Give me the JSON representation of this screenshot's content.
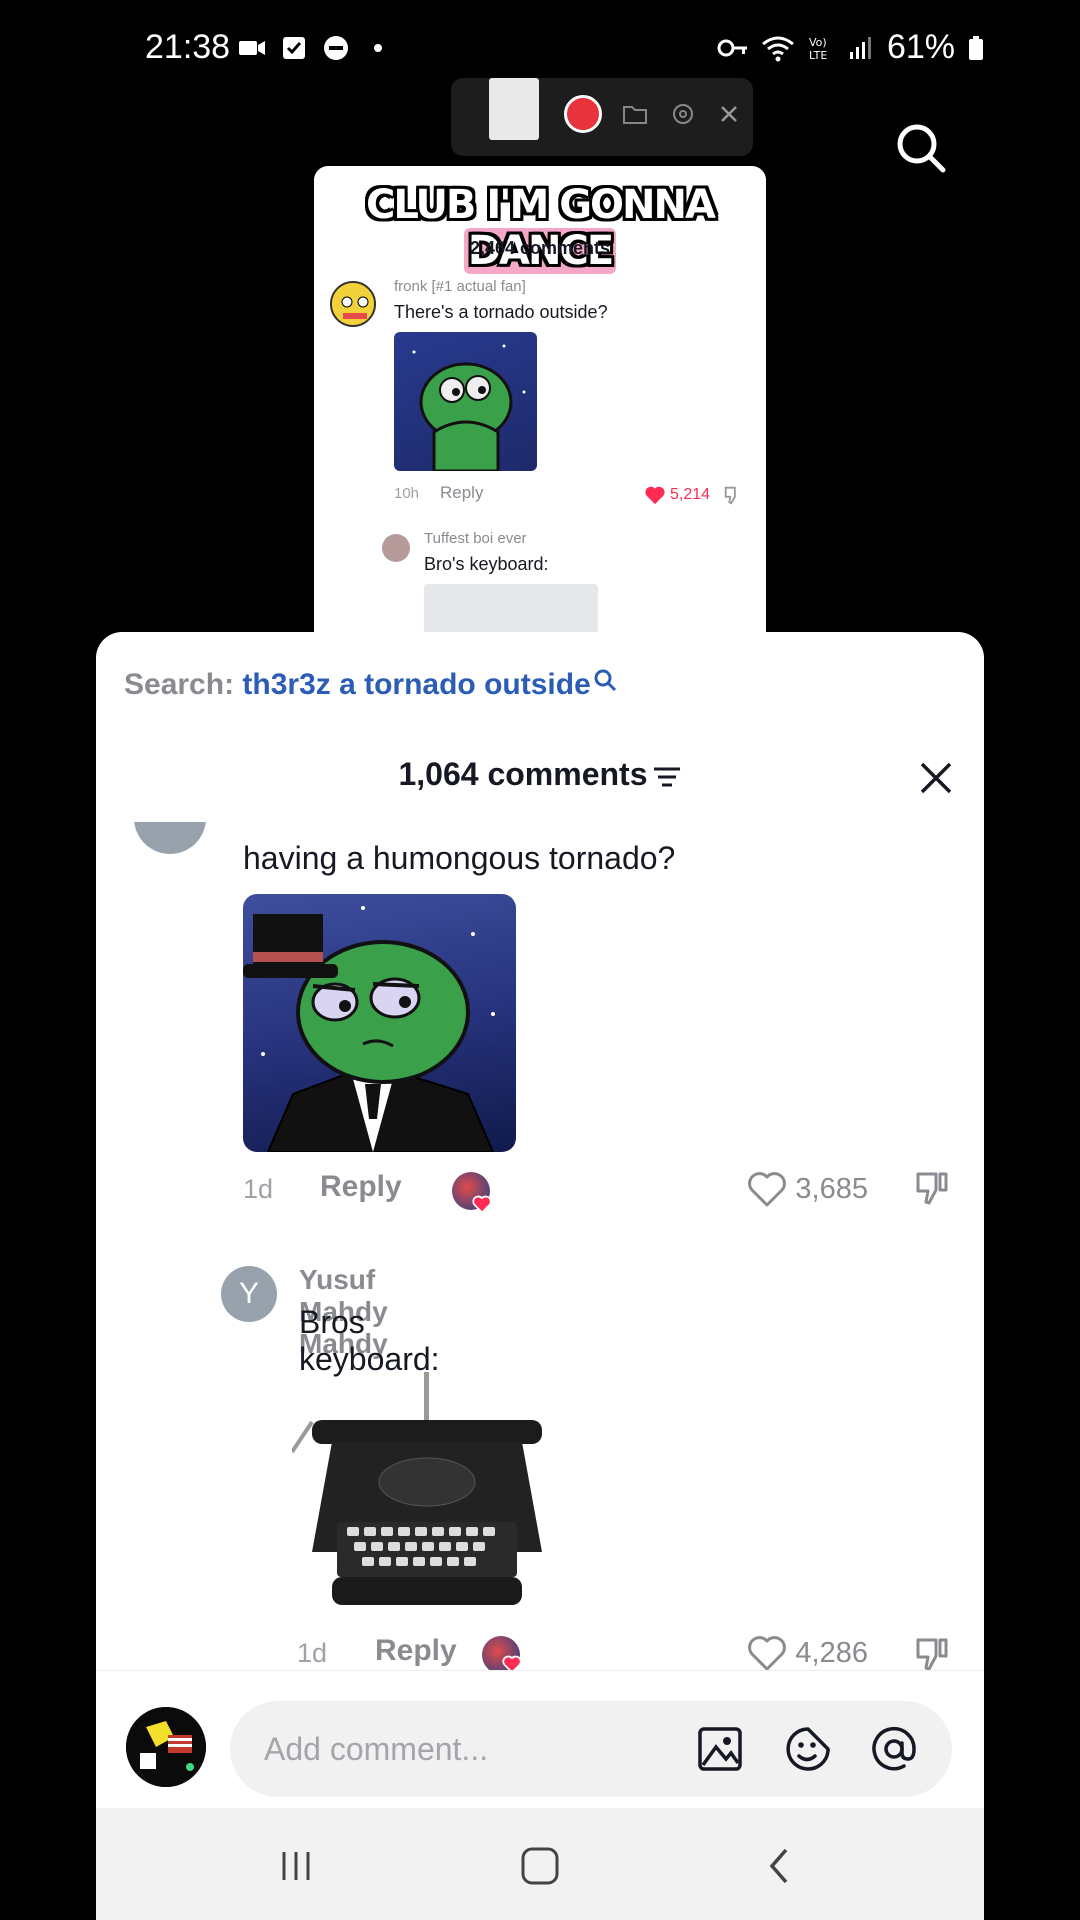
{
  "status": {
    "time": "21:38",
    "battery": "61%"
  },
  "video": {
    "caption_part1": "CLUB I'M GONNA ",
    "caption_part2": "DANCE",
    "comment_count": "2,464 comments",
    "comment_user": "fronk [#1 actual fan]",
    "comment_text": "There's a tornado outside?",
    "comment_time": "10h",
    "comment_reply": "Reply",
    "comment_likes": "5,214",
    "sub_user": "Tuffest boi ever",
    "sub_text": "Bro's keyboard:"
  },
  "sheet": {
    "search_prefix": "Search: ",
    "search_term": "th3r3z a tornado outside",
    "title": "1,064 comments"
  },
  "comments": [
    {
      "text": "having a humongous tornado?",
      "time": "1d",
      "reply": "Reply",
      "likes": "3,685"
    }
  ],
  "reply": {
    "avatar_letter": "Y",
    "user": "Yusuf Mahdy Mahdy",
    "text": "Bros keyboard:",
    "time": "1d",
    "reply": "Reply",
    "likes": "4,286"
  },
  "input": {
    "placeholder": "Add comment..."
  },
  "colors": {
    "accent_red": "#fe2c55",
    "link_blue": "#2b5db6",
    "muted_gray": "#8a8b91"
  },
  "icons": [
    "search-icon",
    "filter-icon",
    "close-icon",
    "heart-icon",
    "dislike-icon",
    "image-icon",
    "emoji-icon",
    "mention-icon",
    "recent-apps-icon",
    "home-icon",
    "back-icon"
  ]
}
